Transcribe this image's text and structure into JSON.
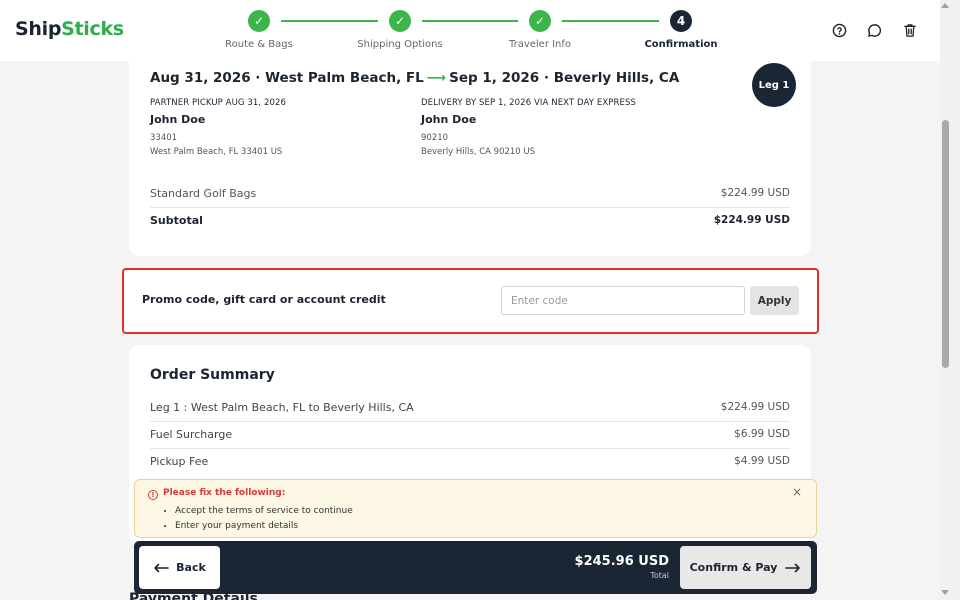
{
  "app": {
    "logo_part1": "Ship",
    "logo_part2": "Sticks"
  },
  "steps": [
    {
      "label": "Route & Bags",
      "status": "done",
      "glyph": "✓"
    },
    {
      "label": "Shipping Options",
      "status": "done",
      "glyph": "✓"
    },
    {
      "label": "Traveler Info",
      "status": "done",
      "glyph": "✓"
    },
    {
      "label": "Confirmation",
      "status": "current",
      "number": "4"
    }
  ],
  "header_icons": [
    "help-icon",
    "chat-icon",
    "trash-icon"
  ],
  "leg": {
    "route_from": "Aug 31, 2026 · West Palm Beach, FL",
    "route_arrow": "⟶",
    "route_to": "Sep 1, 2026 · Beverly Hills, CA",
    "badge": "Leg 1",
    "pickup": {
      "caption": "PARTNER PICKUP AUG 31, 2026",
      "name": "John Doe",
      "zip": "33401",
      "city": "West Palm Beach, FL 33401 US"
    },
    "delivery": {
      "caption": "DELIVERY BY SEP 1, 2026 VIA NEXT DAY EXPRESS",
      "name": "John Doe",
      "zip": "90210",
      "city": "Beverly Hills, CA 90210 US"
    },
    "item_label": "Standard Golf Bags",
    "item_price": "$224.99 USD",
    "subtotal_label": "Subtotal",
    "subtotal_price": "$224.99 USD"
  },
  "promo": {
    "label": "Promo code, gift card or account credit",
    "placeholder": "Enter code",
    "value": "",
    "button": "Apply"
  },
  "summary": {
    "title": "Order Summary",
    "rows": [
      {
        "label": "Leg 1 : West Palm Beach, FL to Beverly Hills, CA",
        "value": "$224.99 USD"
      },
      {
        "label": "Fuel Surcharge",
        "value": "$6.99 USD"
      },
      {
        "label": "Pickup Fee",
        "value": "$4.99 USD"
      }
    ]
  },
  "alert": {
    "icon": "alert-circle-icon",
    "title": "Please fix the following:",
    "items": [
      "Accept the terms of service to continue",
      "Enter your payment details"
    ],
    "close": "×"
  },
  "footer": {
    "back": "Back",
    "total_amount": "$245.96 USD",
    "total_label": "Total",
    "confirm": "Confirm & Pay"
  },
  "next_section_peek": "Payment Details",
  "colors": {
    "green": "#3cb54a",
    "navy": "#1b2634",
    "error": "#e03131"
  }
}
